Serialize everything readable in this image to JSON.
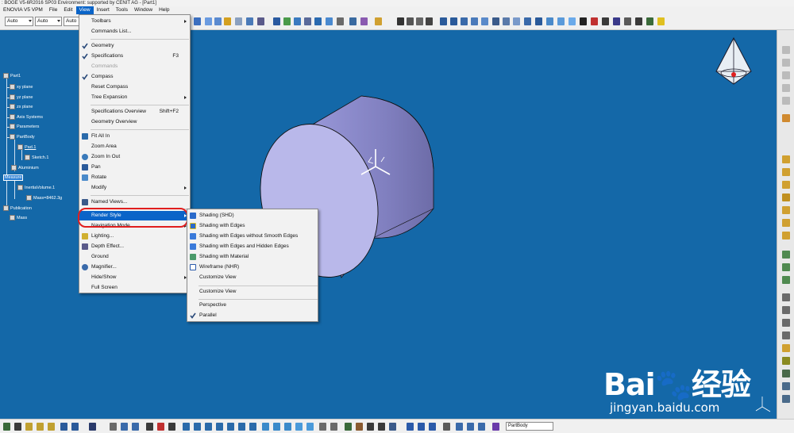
{
  "app": {
    "title": ": BOGE V5-6R2016 SP03 Environment: supported by CENIT AG - [Part1]"
  },
  "menubar": {
    "items": [
      {
        "label": "ENOVIA V5 VPM"
      },
      {
        "label": "File"
      },
      {
        "label": "Edit"
      },
      {
        "label": "View"
      },
      {
        "label": "Insert"
      },
      {
        "label": "Tools"
      },
      {
        "label": "Window"
      },
      {
        "label": "Help"
      }
    ]
  },
  "toolbar": {
    "select1": "Auto",
    "select2": "Auto",
    "select3": "Auto"
  },
  "tree": {
    "items": [
      {
        "label": "Part1"
      },
      {
        "label": "xy plane"
      },
      {
        "label": "yz plane"
      },
      {
        "label": "zx plane"
      },
      {
        "label": "Axis Systems"
      },
      {
        "label": "Parameters"
      },
      {
        "label": "PartBody"
      },
      {
        "label": "Pad.1"
      },
      {
        "label": "Sketch.1"
      },
      {
        "label": "Aluminium"
      },
      {
        "label": "Measure"
      },
      {
        "label": "InertiaVolume.1"
      },
      {
        "label": "Mass=8462.3g"
      },
      {
        "label": "Publication"
      },
      {
        "label": "Mass"
      }
    ]
  },
  "view_menu": {
    "items": [
      {
        "label": "Toolbars"
      },
      {
        "label": "Commands List..."
      },
      {
        "label": "Geometry"
      },
      {
        "label": "Specifications",
        "shortcut": "F3"
      },
      {
        "label": "Commands"
      },
      {
        "label": "Compass"
      },
      {
        "label": "Reset Compass"
      },
      {
        "label": "Tree Expansion"
      },
      {
        "label": "Specifications Overview",
        "shortcut": "Shift+F2"
      },
      {
        "label": "Geometry Overview"
      },
      {
        "label": "Fit All In"
      },
      {
        "label": "Zoom Area"
      },
      {
        "label": "Zoom In Out"
      },
      {
        "label": "Pan"
      },
      {
        "label": "Rotate"
      },
      {
        "label": "Modify"
      },
      {
        "label": "Named Views..."
      },
      {
        "label": "Render Style"
      },
      {
        "label": "Navigation Mode"
      },
      {
        "label": "Lighting..."
      },
      {
        "label": "Depth Effect..."
      },
      {
        "label": "Ground"
      },
      {
        "label": "Magnifier..."
      },
      {
        "label": "Hide/Show"
      },
      {
        "label": "Full Screen"
      }
    ]
  },
  "render_submenu": {
    "items": [
      {
        "label": "Shading (SHD)"
      },
      {
        "label": "Shading with Edges"
      },
      {
        "label": "Shading with Edges without Smooth Edges"
      },
      {
        "label": "Shading with Edges and Hidden Edges"
      },
      {
        "label": "Shading with Material"
      },
      {
        "label": "Wireframe (NHR)"
      },
      {
        "label": "Customize View"
      },
      {
        "label": "Customize View"
      },
      {
        "label": "Perspective"
      },
      {
        "label": "Parallel"
      }
    ]
  },
  "bottombar": {
    "body_select": "PartBody"
  },
  "watermark": {
    "brand": "Bai",
    "brand_cn": "经验",
    "url": "jingyan.baidu.com"
  },
  "colors": {
    "viewport_bg": "#1468a8",
    "menu_highlight": "#0a64c8",
    "annotation_red": "#e01e1e",
    "part_face": "#b9b8ea"
  }
}
